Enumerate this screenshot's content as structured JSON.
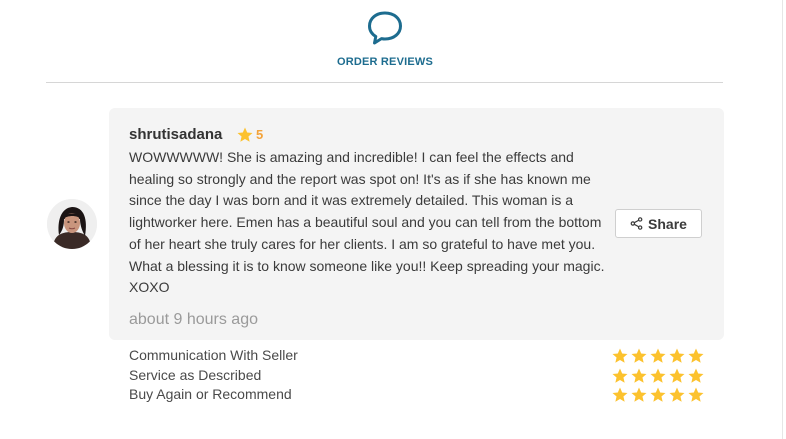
{
  "header": {
    "title": "ORDER REVIEWS",
    "icon": "speech-bubble-icon",
    "accent_color": "#1d6c8f"
  },
  "review": {
    "reviewer_name": "shrutisadana",
    "rating": "5",
    "rating_color": "#f3a33a",
    "text": "WOWWWWW! She is amazing and incredible! I can feel the effects and healing so strongly and the report was spot on! It's as if she has known me since the day I was born and it was extremely detailed. This woman is a lightworker here. Emen has a beautiful soul and you can tell from the bottom of her heart she truly cares for her clients. I am so grateful to have met you. What a blessing it is to know someone like you!! Keep spreading your magic. XOXO",
    "time": "about 9 hours ago",
    "share_label": "Share",
    "share_icon": "share-icon"
  },
  "criteria": [
    {
      "label": "Communication With Seller",
      "stars": 5
    },
    {
      "label": "Service as Described",
      "stars": 5
    },
    {
      "label": "Buy Again or Recommend",
      "stars": 5
    }
  ],
  "star_color": "#fcc22e"
}
